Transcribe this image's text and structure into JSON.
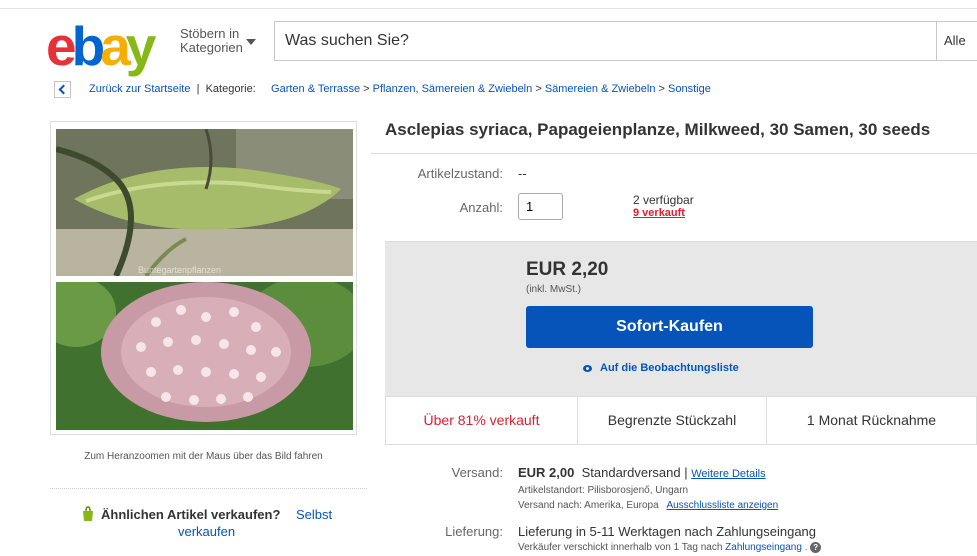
{
  "header": {
    "logo_letters": [
      "e",
      "b",
      "a",
      "y"
    ],
    "logo_colors": [
      "#e53238",
      "#0064d2",
      "#f5af02",
      "#86b817"
    ],
    "categories_label_line1": "Stöbern in",
    "categories_label_line2": "Kategorien",
    "search_placeholder": "Was suchen Sie?",
    "search_category": "Alle"
  },
  "breadcrumb": {
    "back": "Zurück zur Startseite",
    "separator": "|",
    "category_label": "Kategorie:",
    "items": [
      "Garten & Terrasse",
      "Pflanzen, Sämereien & Zwiebeln",
      "Sämereien & Zwiebeln",
      "Sonstige"
    ],
    "arrow": ">"
  },
  "gallery": {
    "watermark": "Buntegartenpflanzen",
    "zoom_hint": "Zum Heranzoomen mit der Maus über das Bild fahren"
  },
  "sell_similar": {
    "question": "Ähnlichen Artikel verkaufen?",
    "link_part1": "Selbst",
    "link_part2": "verkaufen"
  },
  "listing": {
    "title": "Asclepias syriaca, Papageienplanze, Milkweed, 30 Samen, 30 seeds",
    "condition_label": "Artikelzustand:",
    "condition_value": "--",
    "quantity_label": "Anzahl:",
    "quantity_value": "1",
    "available": "2 verfügbar",
    "sold": "9 verkauft"
  },
  "purchase": {
    "price": "EUR 2,20",
    "vat": "(inkl. MwSt.)",
    "buy_now": "Sofort-Kaufen",
    "watchlist": "Auf die Beobachtungsliste"
  },
  "badges": [
    {
      "text": "Über 81% verkauft",
      "highlight": true
    },
    {
      "text": "Begrenzte Stückzahl",
      "highlight": false
    },
    {
      "text": "1 Monat Rücknahme",
      "highlight": false
    }
  ],
  "shipping": {
    "label": "Versand:",
    "price": "EUR 2,00",
    "method": "Standardversand |",
    "details_link": "Weitere Details",
    "location": "Artikelstandort: Pilisborosjenő, Ungarn",
    "ships_to": "Versand nach: Amerika, Europa",
    "exclusions_link": "Ausschlussliste anzeigen"
  },
  "delivery": {
    "label": "Lieferung:",
    "text": "Lieferung in 5-11 Werktagen nach Zahlungseingang",
    "note_prefix": "Verkäufer verschickt innerhalb von 1 Tag nach",
    "note_link": "Zahlungseingang",
    "note_suffix": ".",
    "help_glyph": "?"
  }
}
